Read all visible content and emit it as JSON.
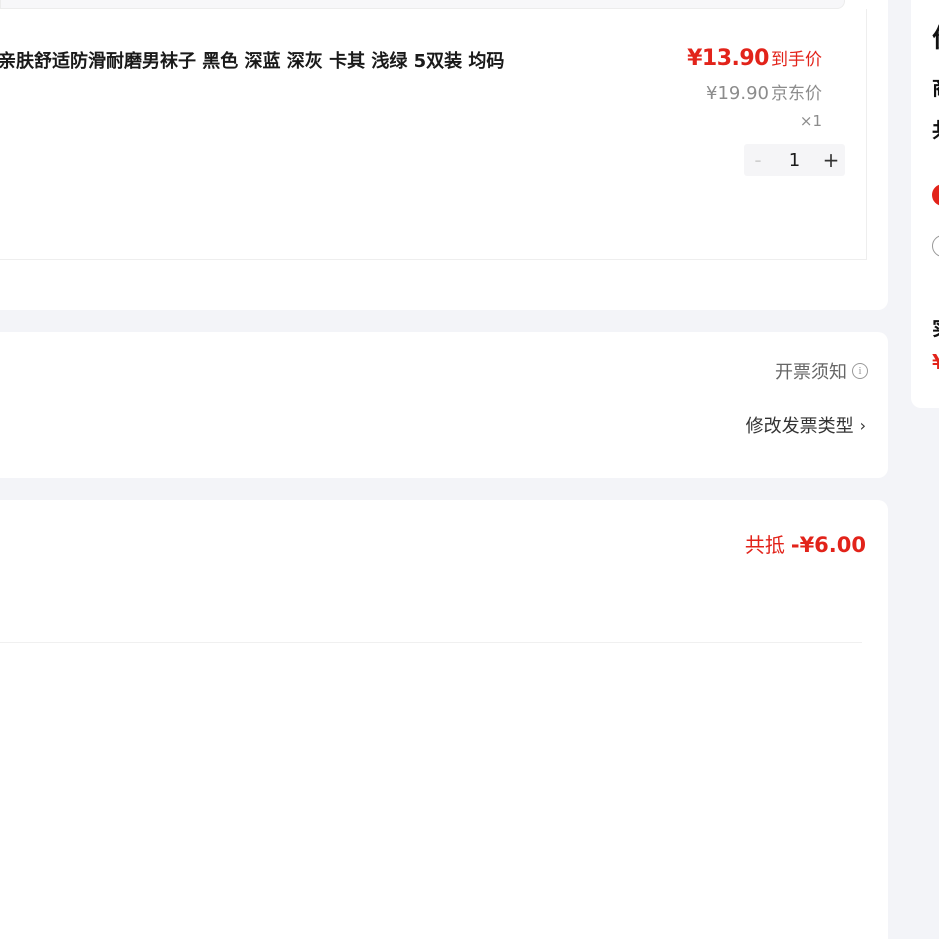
{
  "product": {
    "title": "亲肤舒适防滑耐磨男袜子 黑色 深蓝 深灰 卡其 浅绿 5双装 均码",
    "deal_price": "¥13.90",
    "deal_label": "到手价",
    "original_price": "¥19.90",
    "original_label": "京东价",
    "quantity_multiplier": "×1",
    "stepper": {
      "minus": "-",
      "value": "1",
      "plus": "+"
    }
  },
  "invoice": {
    "notice_label": "开票须知",
    "change_type_label": "修改发票类型"
  },
  "discount": {
    "label": "共抵",
    "amount": "-¥6.00"
  },
  "summary_panel": {
    "frag_title": "价",
    "frag_line1": "商",
    "frag_line2": "共",
    "frag_line3": "实",
    "frag_line4": "¥"
  },
  "colors": {
    "accent_red": "#e2231a",
    "page_bg": "#f3f4f8"
  },
  "icons": [
    "info-icon",
    "chevron-right-icon"
  ]
}
